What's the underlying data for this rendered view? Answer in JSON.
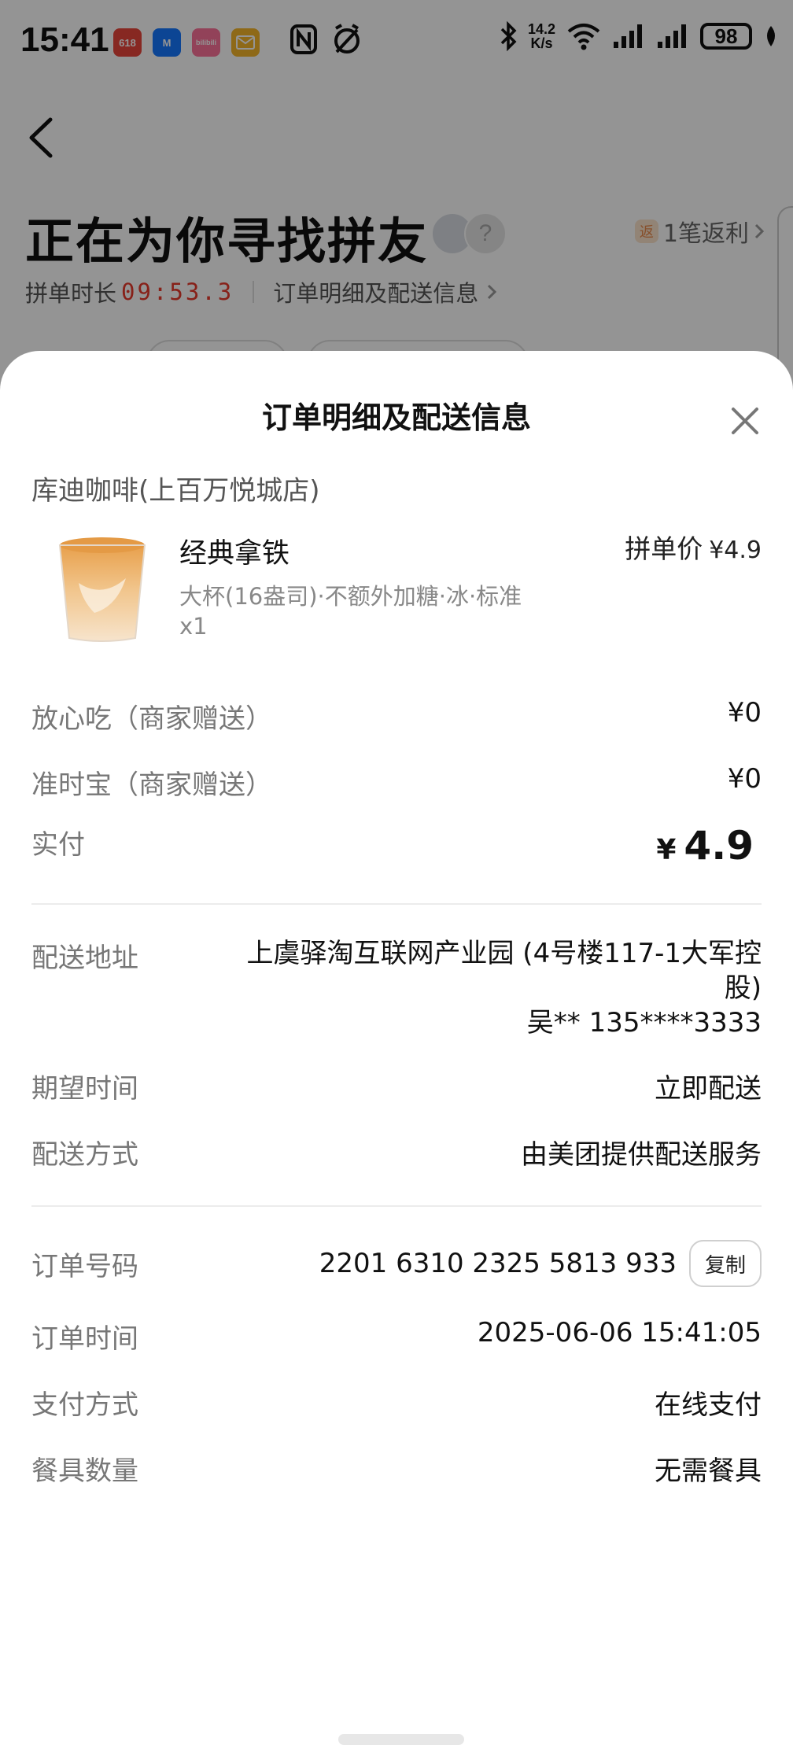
{
  "status_bar": {
    "time": "15:41",
    "net_speed_value": "14.2",
    "net_speed_unit": "K/s",
    "battery": "98",
    "app_icons": [
      "618",
      "M",
      "bilibili",
      "mail"
    ]
  },
  "background": {
    "title": "正在为你寻找拼友",
    "rebate_badge": "返",
    "rebate": "1笔返利",
    "duration_label": "拼单时长",
    "duration_timer": "09:53.3",
    "detail_link": "订单明细及配送信息",
    "avatar_unknown": "?"
  },
  "sheet": {
    "title": "订单明细及配送信息",
    "shop_name": "库迪咖啡(上百万悦城店)",
    "product": {
      "name": "经典拿铁",
      "spec": "大杯(16盎司)·不额外加糖·冰·标准",
      "qty": "x1",
      "price_label": "拼单价",
      "price": "¥4.9"
    },
    "fees": [
      {
        "label": "放心吃（商家赠送）",
        "value": "¥0"
      },
      {
        "label": "准时宝（商家赠送）",
        "value": "¥0"
      }
    ],
    "paid": {
      "label": "实付",
      "currency": "¥",
      "amount": "4.9"
    },
    "delivery": {
      "address_label": "配送地址",
      "address_line1": "上虞驿淘互联网产业园 (4号楼117-1大军控",
      "address_line2": "股)",
      "contact": "吴** 135****3333",
      "time_label": "期望时间",
      "time_value": "立即配送",
      "method_label": "配送方式",
      "method_value": "由美团提供配送服务"
    },
    "order": {
      "number_label": "订单号码",
      "number_value": "2201 6310 2325 5813 933",
      "copy_button": "复制",
      "time_label": "订单时间",
      "time_value": "2025-06-06 15:41:05",
      "payment_label": "支付方式",
      "payment_value": "在线支付",
      "utensils_label": "餐具数量",
      "utensils_value": "无需餐具"
    }
  },
  "colors": {
    "timer_red": "#e8392c",
    "rebate_orange": "#e8894a",
    "overlay": "rgba(0,0,0,0.42)"
  }
}
